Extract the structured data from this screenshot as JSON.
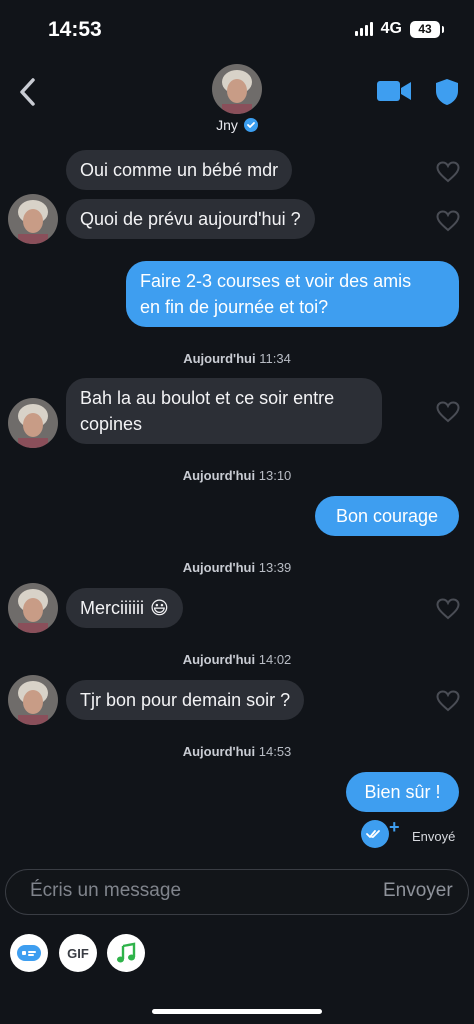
{
  "status_bar": {
    "time": "14:53",
    "network": "4G",
    "battery": "43"
  },
  "header": {
    "contact_name": "Jny"
  },
  "messages": [
    {
      "direction": "in",
      "text": "Oui comme un bébé mdr"
    },
    {
      "direction": "in",
      "text": "Quoi de prévu aujourd'hui ?"
    },
    {
      "direction": "out",
      "line1": "Faire 2-3 courses et voir des amis",
      "line2": "en fin de journée et toi?"
    },
    {
      "direction": "in",
      "line1": "Bah la au boulot et ce soir entre",
      "line2": "copines"
    },
    {
      "direction": "out",
      "text": "Bon courage"
    },
    {
      "direction": "in",
      "text": "Merciiiiii",
      "emoji": "😃"
    },
    {
      "direction": "in",
      "text": "Tjr bon pour demain soir ?"
    },
    {
      "direction": "out",
      "text": "Bien sûr !"
    }
  ],
  "timestamps": [
    {
      "day": "Aujourd'hui",
      "time": "11:34"
    },
    {
      "day": "Aujourd'hui",
      "time": "13:10"
    },
    {
      "day": "Aujourd'hui",
      "time": "13:39"
    },
    {
      "day": "Aujourd'hui",
      "time": "14:02"
    },
    {
      "day": "Aujourd'hui",
      "time": "14:53"
    }
  ],
  "delivery": {
    "status": "Envoyé"
  },
  "composer": {
    "placeholder": "Écris un message",
    "send_label": "Envoyer"
  },
  "toolbar": {
    "gif_label": "GIF"
  },
  "colors": {
    "background": "#111419",
    "incoming_bubble": "#2c2f36",
    "outgoing_bubble": "#3e9ef0",
    "accent": "#3e9ef0"
  },
  "icons": [
    "back-chevron-icon",
    "video-call-icon",
    "shield-icon",
    "verified-icon",
    "heart-icon",
    "sticker-icon",
    "music-note-icon",
    "double-check-icon"
  ]
}
